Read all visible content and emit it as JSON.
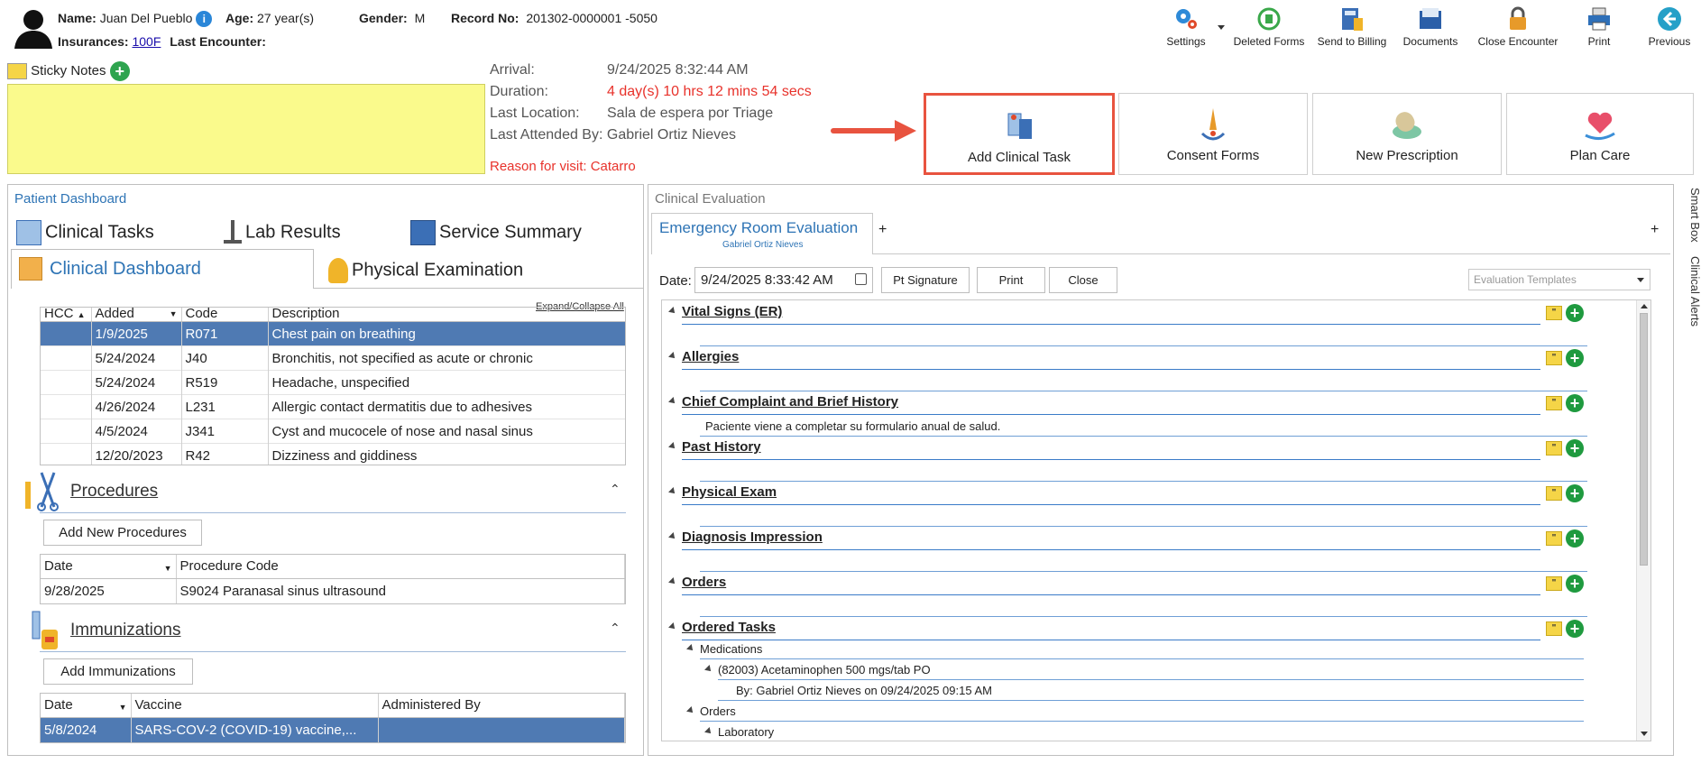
{
  "patient": {
    "name_label": "Name:",
    "name": "Juan Del Pueblo",
    "age_label": "Age:",
    "age": "27 year(s)",
    "gender_label": "Gender:",
    "gender": "M",
    "record_label": "Record No:",
    "record": "201302-0000001 -5050",
    "insurances_label": "Insurances:",
    "insurance": "100F",
    "last_encounter_label": "Last Encounter:"
  },
  "sticky": {
    "label": "Sticky Notes"
  },
  "visit": {
    "arrival_label": "Arrival:",
    "arrival": "9/24/2025 8:32:44 AM",
    "duration_label": "Duration:",
    "duration": "4 day(s) 10 hrs 12 mins 54 secs",
    "last_location_label": "Last Location:",
    "last_location": "Sala de espera por Triage",
    "last_attended_label": "Last Attended By:",
    "last_attended": "Gabriel Ortiz Nieves",
    "reason": "Reason for visit: Catarro"
  },
  "toolbar": {
    "settings": "Settings",
    "deleted_forms": "Deleted Forms",
    "send_billing": "Send to Billing",
    "documents": "Documents",
    "close_encounter": "Close Encounter",
    "print": "Print",
    "previous": "Previous"
  },
  "actions": {
    "add_task": "Add Clinical Task",
    "consent": "Consent Forms",
    "prescription": "New Prescription",
    "plan_care": "Plan Care"
  },
  "dashboard": {
    "title": "Patient Dashboard",
    "tabs": {
      "clinical_tasks": "Clinical Tasks",
      "lab_results": "Lab Results",
      "service_summary": "Service Summary",
      "clinical_dashboard": "Clinical Dashboard",
      "physical_exam": "Physical Examination"
    },
    "expand_collapse": "Expand/Collapse All",
    "diag_headers": [
      "HCC",
      "Added",
      "Code",
      "Description"
    ],
    "diag_rows": [
      {
        "added": "1/9/2025",
        "code": "R071",
        "desc": "Chest pain on breathing"
      },
      {
        "added": "5/24/2024",
        "code": "J40",
        "desc": "Bronchitis, not specified as acute or chronic"
      },
      {
        "added": "5/24/2024",
        "code": "R519",
        "desc": "Headache, unspecified"
      },
      {
        "added": "4/26/2024",
        "code": "L231",
        "desc": "Allergic contact dermatitis due to adhesives"
      },
      {
        "added": "4/5/2024",
        "code": "J341",
        "desc": "Cyst and mucocele of nose and nasal sinus"
      },
      {
        "added": "12/20/2023",
        "code": "R42",
        "desc": "Dizziness and giddiness"
      }
    ],
    "procedures": {
      "title": "Procedures",
      "add_btn": "Add New Procedures",
      "headers": [
        "Date",
        "Procedure Code"
      ],
      "rows": [
        {
          "date": "9/28/2025",
          "code": "S9024 Paranasal sinus ultrasound"
        }
      ]
    },
    "immunizations": {
      "title": "Immunizations",
      "add_btn": "Add Immunizations",
      "headers": [
        "Date",
        "Vaccine",
        "Administered By"
      ],
      "rows": [
        {
          "date": "5/8/2024",
          "vaccine": "SARS-COV-2 (COVID-19) vaccine,...",
          "by": ""
        }
      ]
    }
  },
  "evaluation": {
    "title": "Clinical Evaluation",
    "tab": "Emergency Room Evaluation",
    "tab_sub": "Gabriel Ortiz Nieves",
    "date_label": "Date:",
    "date": "9/24/2025 8:33:42 AM",
    "pt_signature": "Pt Signature",
    "print": "Print",
    "close": "Close",
    "templates_placeholder": "Evaluation Templates",
    "sections": {
      "vital": "Vital Signs (ER)",
      "allergies": "Allergies",
      "chief": "Chief Complaint and Brief History",
      "chief_text": "Paciente viene a completar su formulario anual de salud.",
      "past": "Past History",
      "physical": "Physical Exam",
      "diagnosis": "Diagnosis Impression",
      "orders": "Orders",
      "ordered_tasks": "Ordered Tasks"
    },
    "tree": {
      "medications": "Medications",
      "med_item": "(82003) Acetaminophen 500 mgs/tab PO",
      "med_by": "By: Gabriel Ortiz Nieves on 09/24/2025 09:15 AM",
      "orders": "Orders",
      "laboratory": "Laboratory"
    }
  },
  "side": {
    "smart_box": "Smart Box",
    "clinical_alerts": "Clinical Alerts"
  },
  "colors": {
    "accent": "#2e74b5",
    "selected_row": "#4f7ab3",
    "sticky": "#fafa8c",
    "red": "#e8322b"
  }
}
